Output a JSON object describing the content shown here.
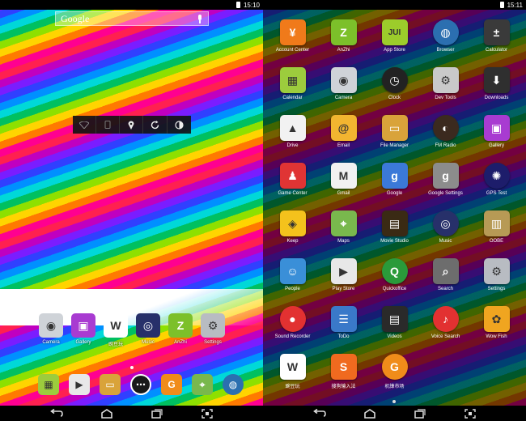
{
  "left": {
    "status_time": "15:10",
    "search_label": "Google",
    "home_apps": [
      {
        "label": "Camera",
        "icon": "camera-icon",
        "color": "#cfd3d8",
        "glyph": "◉"
      },
      {
        "label": "Gallery",
        "icon": "gallery-icon",
        "color": "#a83bd1",
        "glyph": "▣"
      },
      {
        "label": "豌豆玩",
        "icon": "wandoujia-icon",
        "color": "#ffffff",
        "glyph": "W"
      },
      {
        "label": "Music",
        "icon": "music-icon",
        "color": "#27306a",
        "glyph": "◎"
      },
      {
        "label": "AnZhi",
        "icon": "anzhi-icon",
        "color": "#7cc02a",
        "glyph": "Z"
      },
      {
        "label": "Settings",
        "icon": "settings-icon",
        "color": "#b8bcc2",
        "glyph": "⚙"
      }
    ],
    "dock": [
      {
        "icon": "calendar-icon",
        "color": "#9ccc3d",
        "glyph": "▦"
      },
      {
        "icon": "play-store-icon",
        "color": "#e8e8e8",
        "glyph": "▶"
      },
      {
        "icon": "file-manager-icon",
        "color": "#d9a33a",
        "glyph": "▭"
      },
      {
        "icon": "app-drawer-icon",
        "color": "#1a1a1a",
        "glyph": "⋯"
      },
      {
        "icon": "g-market-icon",
        "color": "#f08c1a",
        "glyph": "G"
      },
      {
        "icon": "maps-icon",
        "color": "#79b84d",
        "glyph": "⌖"
      },
      {
        "icon": "browser-icon",
        "color": "#2b6fb0",
        "glyph": "◍"
      }
    ]
  },
  "right": {
    "status_time": "15:11",
    "apps": [
      {
        "label": "Account Center",
        "icon": "account-center-icon",
        "color": "#f07a1a",
        "glyph": "¥"
      },
      {
        "label": "AnZhi",
        "icon": "anzhi-icon",
        "color": "#7cc02a",
        "glyph": "Z"
      },
      {
        "label": "App Store",
        "icon": "app-store-icon",
        "color": "#9ccc2b",
        "glyph": "JUI"
      },
      {
        "label": "Browser",
        "icon": "browser-icon",
        "color": "#2b6fb0",
        "glyph": "◍"
      },
      {
        "label": "Calculator",
        "icon": "calculator-icon",
        "color": "#3a3a3a",
        "glyph": "±"
      },
      {
        "label": "Calendar",
        "icon": "calendar-icon",
        "color": "#9ccc3d",
        "glyph": "▦"
      },
      {
        "label": "Camera",
        "icon": "camera-icon",
        "color": "#cfd3d8",
        "glyph": "◉"
      },
      {
        "label": "Clock",
        "icon": "clock-icon",
        "color": "#222222",
        "glyph": "◷"
      },
      {
        "label": "Dev Tools",
        "icon": "dev-tools-icon",
        "color": "#c9c9c9",
        "glyph": "⚙"
      },
      {
        "label": "Downloads",
        "icon": "downloads-icon",
        "color": "#2f2f2f",
        "glyph": "⬇"
      },
      {
        "label": "Drive",
        "icon": "drive-icon",
        "color": "#f2f2f2",
        "glyph": "▲"
      },
      {
        "label": "Email",
        "icon": "email-icon",
        "color": "#f2b530",
        "glyph": "@"
      },
      {
        "label": "File Manager",
        "icon": "file-manager-icon",
        "color": "#d9a33a",
        "glyph": "▭"
      },
      {
        "label": "FM Radio",
        "icon": "fm-radio-icon",
        "color": "#3b2a1f",
        "glyph": "◐"
      },
      {
        "label": "Gallery",
        "icon": "gallery-icon",
        "color": "#a83bd1",
        "glyph": "▣"
      },
      {
        "label": "Game Center",
        "icon": "game-center-icon",
        "color": "#e03434",
        "glyph": "♟"
      },
      {
        "label": "Gmail",
        "icon": "gmail-icon",
        "color": "#f1f1f1",
        "glyph": "M"
      },
      {
        "label": "Google",
        "icon": "google-icon",
        "color": "#3b79d8",
        "glyph": "g"
      },
      {
        "label": "Google Settings",
        "icon": "google-settings-icon",
        "color": "#8c8c8c",
        "glyph": "g"
      },
      {
        "label": "GPS Test",
        "icon": "gps-test-icon",
        "color": "#1d1d6b",
        "glyph": "✺"
      },
      {
        "label": "Keep",
        "icon": "keep-icon",
        "color": "#f4c21c",
        "glyph": "◈"
      },
      {
        "label": "Maps",
        "icon": "maps-icon",
        "color": "#79b84d",
        "glyph": "⌖"
      },
      {
        "label": "Movie Studio",
        "icon": "movie-studio-icon",
        "color": "#3a2a14",
        "glyph": "▤"
      },
      {
        "label": "Music",
        "icon": "music-icon",
        "color": "#27306a",
        "glyph": "◎"
      },
      {
        "label": "OOBE",
        "icon": "oobe-icon",
        "color": "#b79a55",
        "glyph": "▥"
      },
      {
        "label": "People",
        "icon": "people-icon",
        "color": "#3a8fd8",
        "glyph": "☺"
      },
      {
        "label": "Play Store",
        "icon": "play-store-icon",
        "color": "#e8e8e8",
        "glyph": "▶"
      },
      {
        "label": "Quickoffice",
        "icon": "quickoffice-icon",
        "color": "#2a9a3a",
        "glyph": "Q"
      },
      {
        "label": "Search",
        "icon": "search-icon",
        "color": "#6d6d6d",
        "glyph": "⌕"
      },
      {
        "label": "Settings",
        "icon": "settings-icon",
        "color": "#b8bcc2",
        "glyph": "⚙"
      },
      {
        "label": "Sound Recorder",
        "icon": "sound-recorder-icon",
        "color": "#e23131",
        "glyph": "●"
      },
      {
        "label": "ToDo",
        "icon": "todo-icon",
        "color": "#3a79c9",
        "glyph": "☰"
      },
      {
        "label": "Videos",
        "icon": "videos-icon",
        "color": "#2a2a2a",
        "glyph": "▤"
      },
      {
        "label": "Voice Search",
        "icon": "voice-search-icon",
        "color": "#e23131",
        "glyph": "♪"
      },
      {
        "label": "Wow Fish",
        "icon": "wow-fish-icon",
        "color": "#f0a520",
        "glyph": "✿"
      },
      {
        "label": "豌豆玩",
        "icon": "wandoujia-icon",
        "color": "#ffffff",
        "glyph": "W"
      },
      {
        "label": "搜狗输入法",
        "icon": "sogou-input-icon",
        "color": "#f06a1f",
        "glyph": "S"
      },
      {
        "label": "机锋市场",
        "icon": "gfan-market-icon",
        "color": "#f08c1a",
        "glyph": "G"
      }
    ]
  }
}
